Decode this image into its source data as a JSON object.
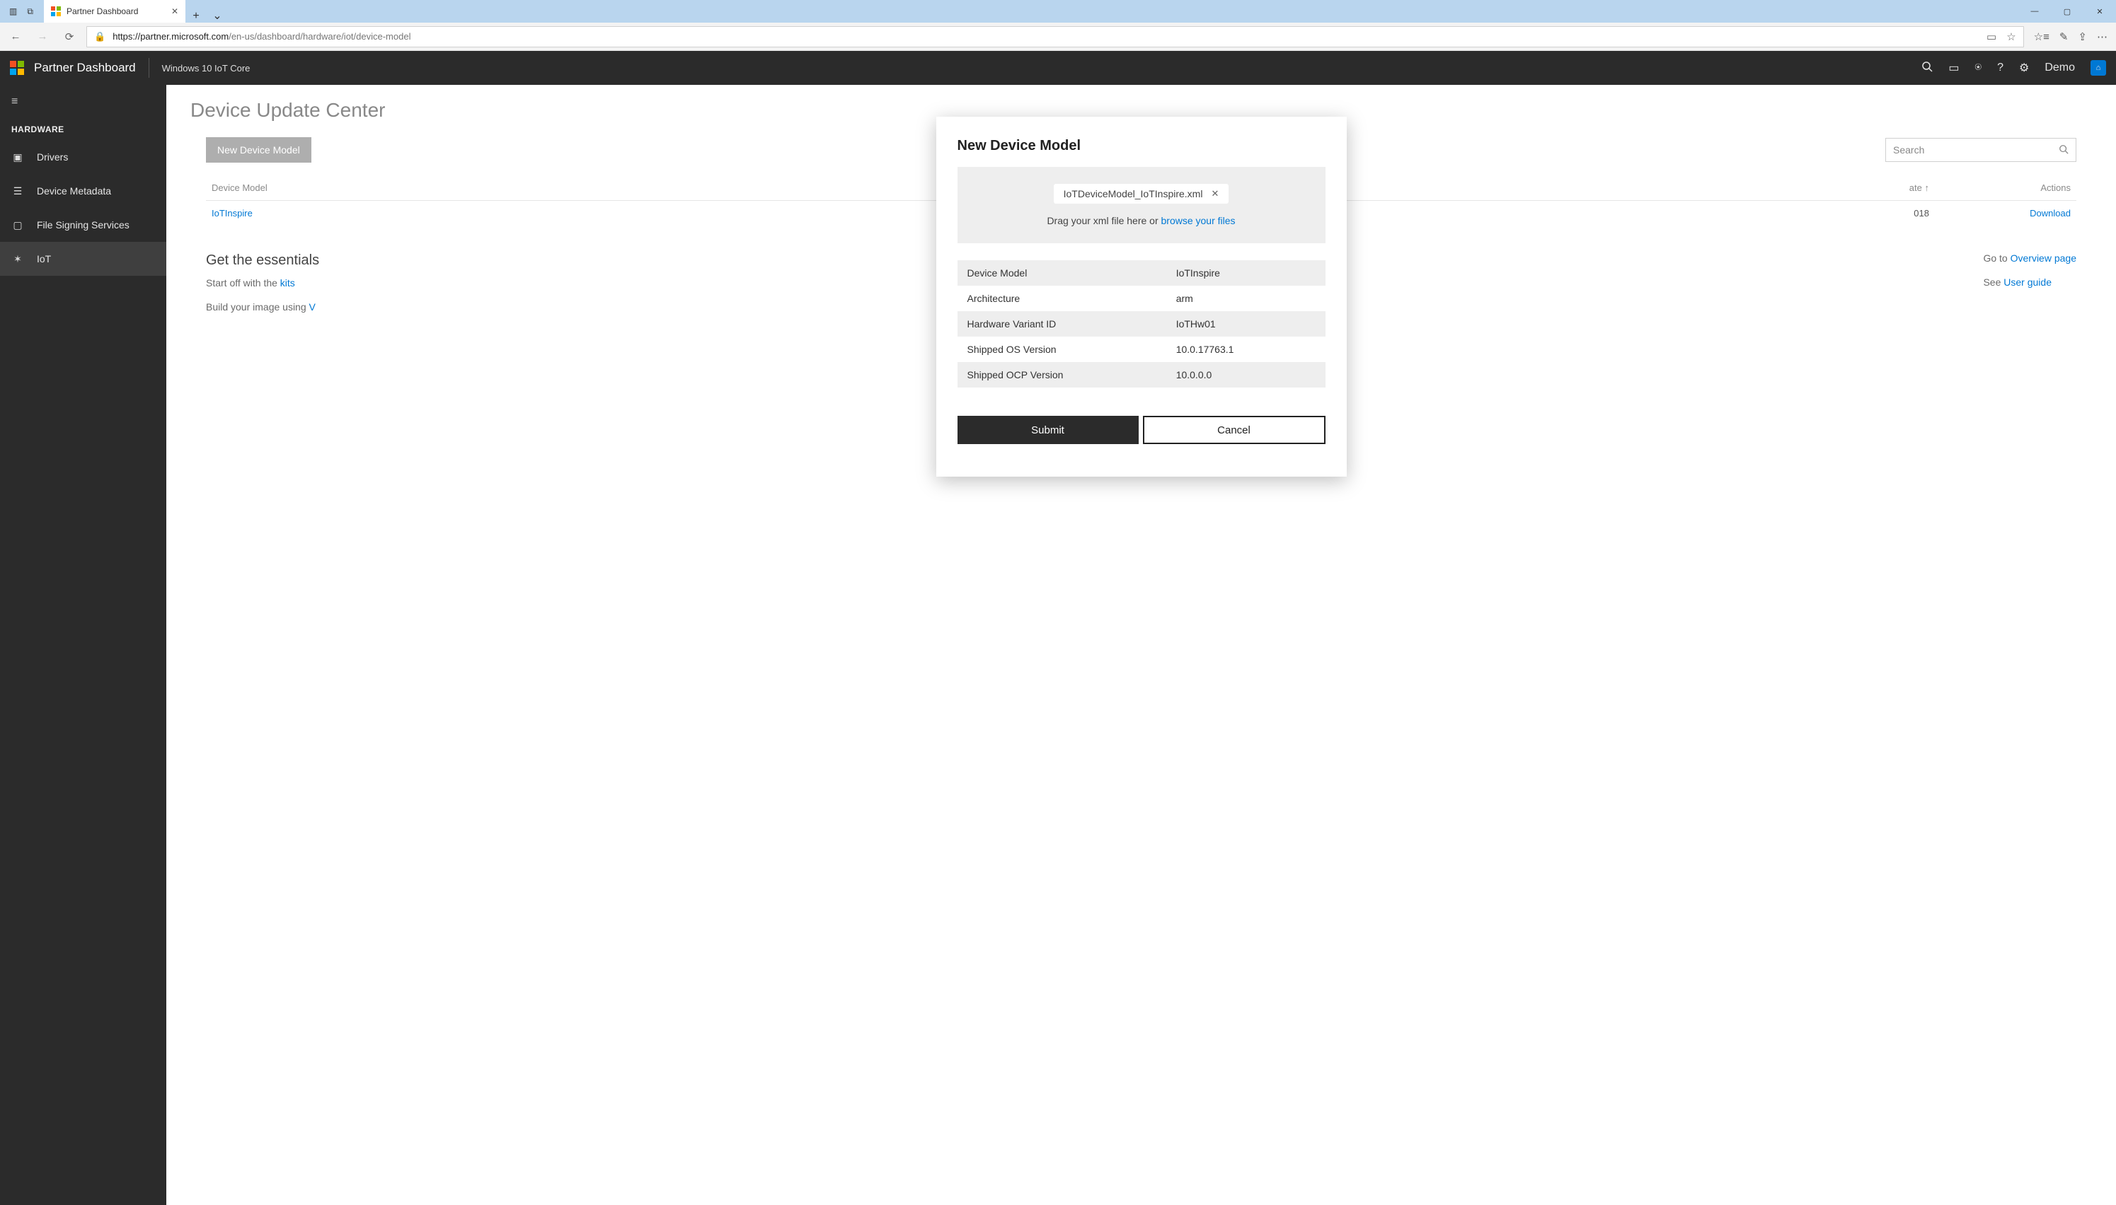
{
  "browser": {
    "tab_title": "Partner Dashboard",
    "url_display_host": "https://partner.microsoft.com",
    "url_display_path": "/en-us/dashboard/hardware/iot/device-model"
  },
  "header": {
    "app_title": "Partner Dashboard",
    "context": "Windows 10 IoT Core",
    "user_label": "Demo"
  },
  "sidebar": {
    "group_title": "HARDWARE",
    "items": [
      {
        "icon": "drivers",
        "label": "Drivers"
      },
      {
        "icon": "metadata",
        "label": "Device Metadata"
      },
      {
        "icon": "signing",
        "label": "File Signing Services"
      },
      {
        "icon": "iot",
        "label": "IoT"
      }
    ],
    "active_index": 3
  },
  "page": {
    "title": "Device Update Center",
    "new_button": "New Device Model",
    "search_placeholder": "Search",
    "columns": {
      "model": "Device Model",
      "date": "ate",
      "actions": "Actions"
    },
    "rows": [
      {
        "model": "IoTInspire",
        "date": "018",
        "action": "Download"
      }
    ],
    "essentials": {
      "heading": "Get the essentials",
      "kits_pre": "Start off with the ",
      "kits_link": "kits",
      "build_pre": "Build your image using ",
      "build_cutoff": "V",
      "goto_pre": "Go to ",
      "goto_link": "Overview page",
      "see_pre": "See ",
      "see_link": "User guide"
    }
  },
  "modal": {
    "title": "New Device Model",
    "file_name": "IoTDeviceModel_IoTInspire.xml",
    "drop_pre": "Drag your xml file here or ",
    "drop_link": "browse your files",
    "properties": [
      {
        "label": "Device Model",
        "value": "IoTInspire"
      },
      {
        "label": "Architecture",
        "value": "arm"
      },
      {
        "label": "Hardware Variant ID",
        "value": "IoTHw01"
      },
      {
        "label": "Shipped OS Version",
        "value": "10.0.17763.1"
      },
      {
        "label": "Shipped OCP Version",
        "value": "10.0.0.0"
      }
    ],
    "submit": "Submit",
    "cancel": "Cancel"
  }
}
